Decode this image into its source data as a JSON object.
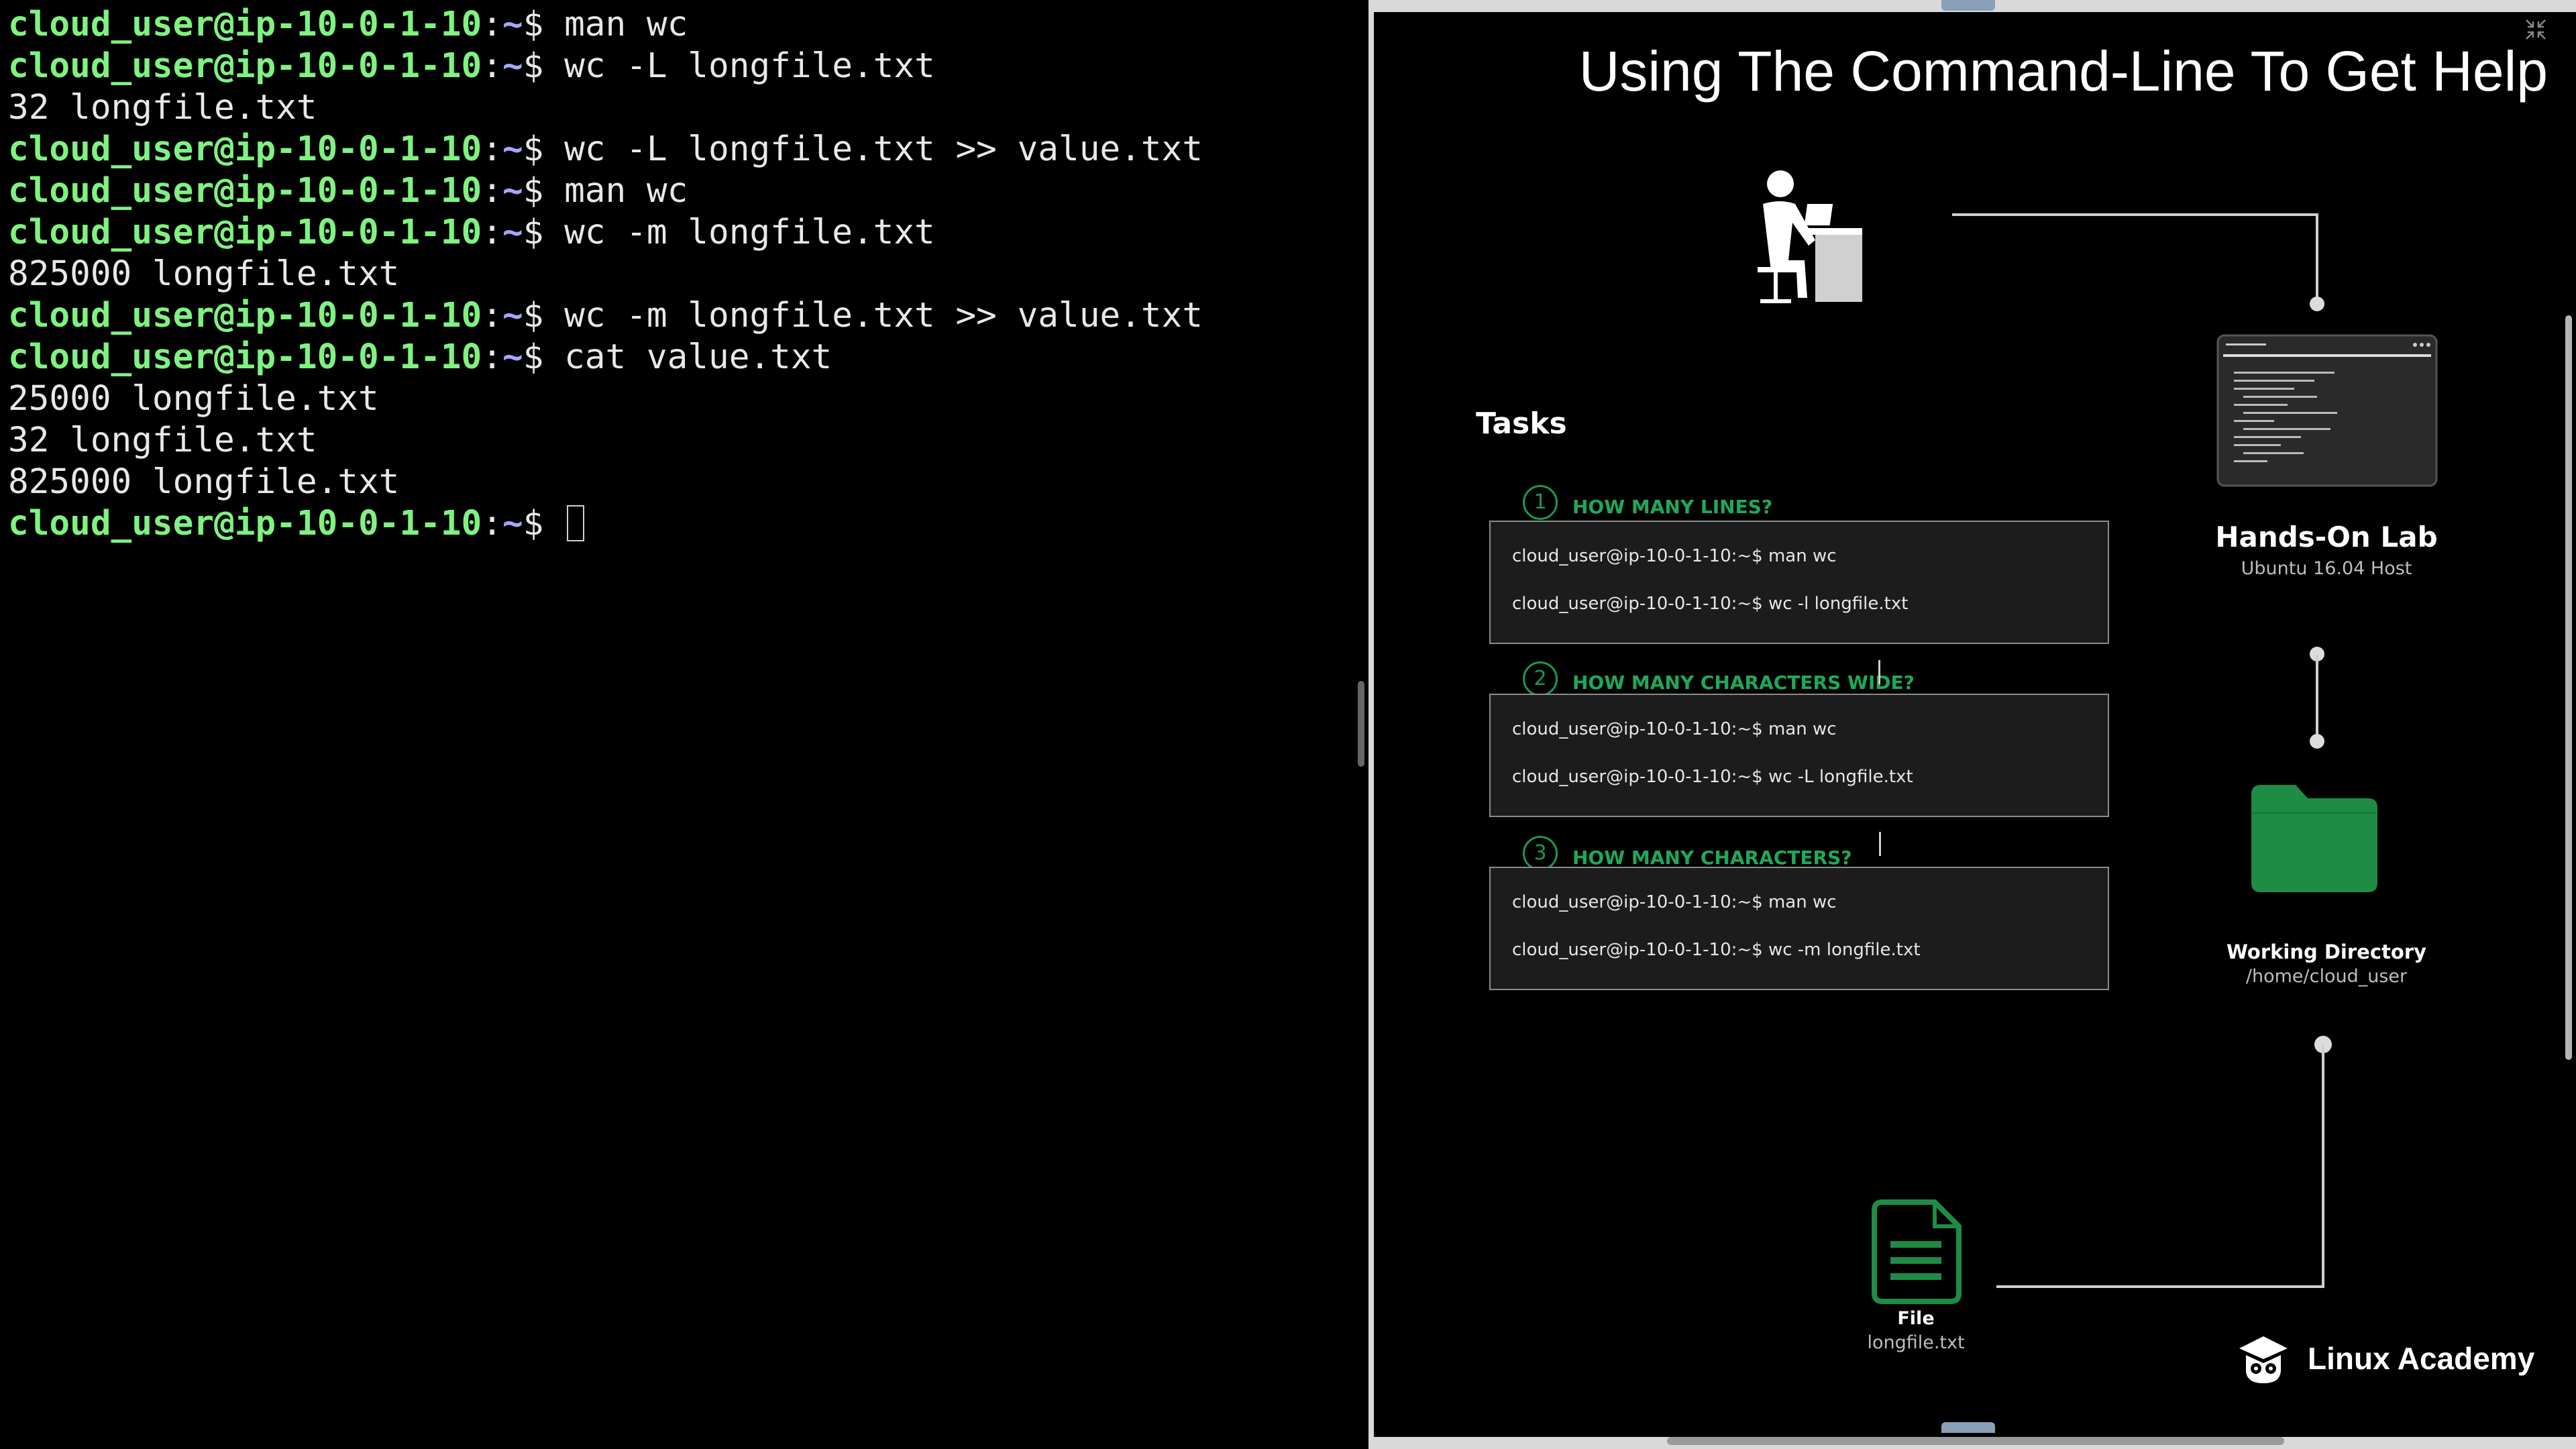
{
  "terminal": {
    "lines": [
      {
        "user": "cloud_user@ip-10-0-1-10",
        "path": "~",
        "prompt": "$ ",
        "cmd": "man wc"
      },
      {
        "user": "cloud_user@ip-10-0-1-10",
        "path": "~",
        "prompt": "$ ",
        "cmd": "wc -L longfile.txt"
      },
      {
        "output": "32 longfile.txt"
      },
      {
        "user": "cloud_user@ip-10-0-1-10",
        "path": "~",
        "prompt": "$ ",
        "cmd": "wc -L longfile.txt >> value.txt"
      },
      {
        "user": "cloud_user@ip-10-0-1-10",
        "path": "~",
        "prompt": "$ ",
        "cmd": "man wc"
      },
      {
        "user": "cloud_user@ip-10-0-1-10",
        "path": "~",
        "prompt": "$ ",
        "cmd": "wc -m longfile.txt"
      },
      {
        "output": "825000 longfile.txt"
      },
      {
        "user": "cloud_user@ip-10-0-1-10",
        "path": "~",
        "prompt": "$ ",
        "cmd": "wc -m longfile.txt >> value.txt"
      },
      {
        "user": "cloud_user@ip-10-0-1-10",
        "path": "~",
        "prompt": "$ ",
        "cmd": "cat value.txt"
      },
      {
        "output": "25000 longfile.txt"
      },
      {
        "output": "32 longfile.txt"
      },
      {
        "output": "825000 longfile.txt"
      },
      {
        "user": "cloud_user@ip-10-0-1-10",
        "path": "~",
        "prompt": "$ ",
        "cmd": "",
        "cursor": true
      }
    ]
  },
  "slide": {
    "title": "Using The Command-Line To Get Help",
    "tasks_heading": "Tasks",
    "tasks": [
      {
        "num": "1",
        "title": "HOW MANY LINES?",
        "commands": [
          "cloud_user@ip-10-0-1-10:~$ man wc",
          "cloud_user@ip-10-0-1-10:~$ wc -l longfile.txt"
        ]
      },
      {
        "num": "2",
        "title": "HOW MANY CHARACTERS WIDE?",
        "commands": [
          "cloud_user@ip-10-0-1-10:~$ man wc",
          "cloud_user@ip-10-0-1-10:~$ wc -L longfile.txt"
        ]
      },
      {
        "num": "3",
        "title": "HOW MANY CHARACTERS?",
        "commands": [
          "cloud_user@ip-10-0-1-10:~$ man wc",
          "cloud_user@ip-10-0-1-10:~$ wc -m longfile.txt"
        ]
      }
    ],
    "lab": {
      "title": "Hands-On Lab",
      "subtitle": "Ubuntu 16.04 Host"
    },
    "working_dir": {
      "title": "Working Directory",
      "path": "/home/cloud_user"
    },
    "file": {
      "title": "File",
      "name": "longfile.txt"
    },
    "brand": "Linux Academy",
    "colors": {
      "accent": "#1a9a4c",
      "task_title": "#1fa85a",
      "prompt_user": "#7ff27f",
      "prompt_path": "#a3a8ff"
    },
    "icons": [
      "person-at-desk-icon",
      "terminal-window-icon",
      "folder-icon",
      "file-icon",
      "linux-academy-owl-icon",
      "collapse-icon"
    ]
  }
}
